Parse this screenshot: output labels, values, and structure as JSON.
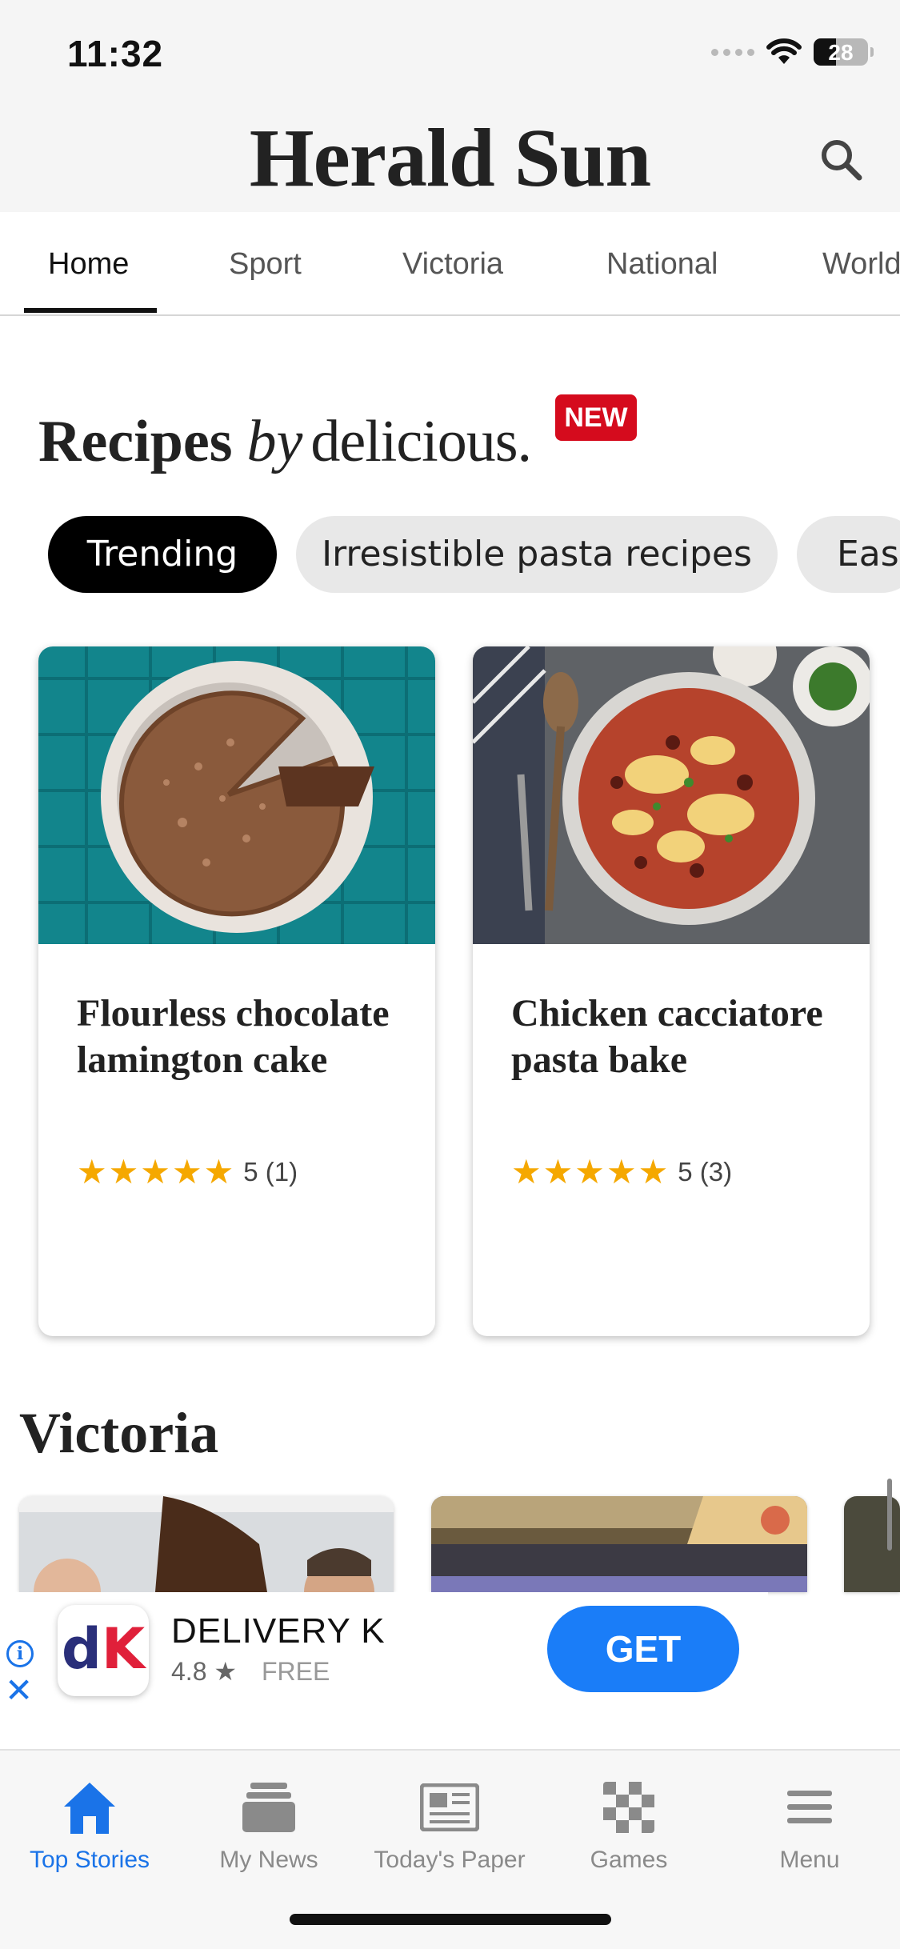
{
  "status_bar": {
    "time": "11:32",
    "battery": "28"
  },
  "header": {
    "masthead": "Herald Sun",
    "search_icon": "search-icon"
  },
  "section_tabs": [
    {
      "label": "Home",
      "active": true
    },
    {
      "label": "Sport"
    },
    {
      "label": "Victoria"
    },
    {
      "label": "National"
    },
    {
      "label": "World"
    }
  ],
  "recipes": {
    "title_bold": "Recipes",
    "title_by": "by",
    "title_brand": "delicious.",
    "badge": "NEW",
    "chips": [
      {
        "label": "Trending",
        "active": true
      },
      {
        "label": "Irresistible pasta recipes"
      },
      {
        "label": "Easy"
      }
    ],
    "cards": [
      {
        "title": "Flourless chocolate lamington cake",
        "stars": "★★★★★",
        "rating": "5 (1)"
      },
      {
        "title": "Chicken cacciatore pasta bake",
        "stars": "★★★★★",
        "rating": "5 (3)"
      }
    ]
  },
  "victoria": {
    "title": "Victoria"
  },
  "ad": {
    "icon_letter_1": "d",
    "icon_letter_2": "K",
    "name": "DELIVERY K",
    "rating": "4.8 ★",
    "price": "FREE",
    "cta": "GET"
  },
  "bottom_nav": [
    {
      "label": "Top Stories",
      "icon": "home-icon",
      "active": true
    },
    {
      "label": "My News",
      "icon": "my-news-icon"
    },
    {
      "label": "Today's Paper",
      "icon": "newspaper-icon"
    },
    {
      "label": "Games",
      "icon": "games-icon"
    },
    {
      "label": "Menu",
      "icon": "menu-icon"
    }
  ],
  "colors": {
    "accent": "#1a73e8",
    "badge_red": "#d50b1d",
    "star": "#f5a800",
    "get_button": "#1a7df8"
  }
}
